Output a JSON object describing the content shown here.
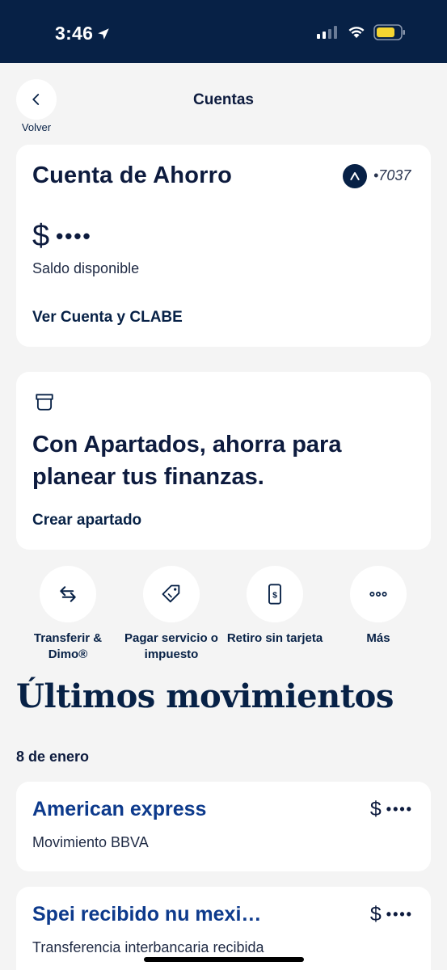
{
  "status": {
    "time": "3:46"
  },
  "nav": {
    "back_label": "Volver",
    "title": "Cuentas"
  },
  "account": {
    "title": "Cuenta de Ahorro",
    "number": "•7037",
    "currency": "$",
    "balance_masked": "••••",
    "balance_label": "Saldo disponible",
    "link": "Ver Cuenta y CLABE"
  },
  "apartados": {
    "text": "Con Apartados, ahorra para planear tus finanzas.",
    "link": "Crear apartado"
  },
  "actions": [
    {
      "label": "Transferir & Dimo®",
      "icon": "transfer-arrows-icon"
    },
    {
      "label": "Pagar servicio o impuesto",
      "icon": "tag-icon"
    },
    {
      "label": "Retiro sin tarjeta",
      "icon": "phone-dollar-icon"
    },
    {
      "label": "Más",
      "icon": "more-dots-icon"
    }
  ],
  "movements": {
    "title": "Últimos movimientos",
    "date": "8 de enero",
    "items": [
      {
        "title": "American express",
        "subtitle": "Movimiento BBVA",
        "currency": "$",
        "amount_masked": "••••"
      },
      {
        "title": "Spei recibido nu mexi…",
        "subtitle": "Transferencia interbancaria recibida",
        "currency": "$",
        "amount_masked": "••••"
      }
    ]
  },
  "colors": {
    "navy": "#072146",
    "background": "#f4f4f4",
    "link_blue": "#0d3a8c",
    "battery": "#f5d531"
  }
}
